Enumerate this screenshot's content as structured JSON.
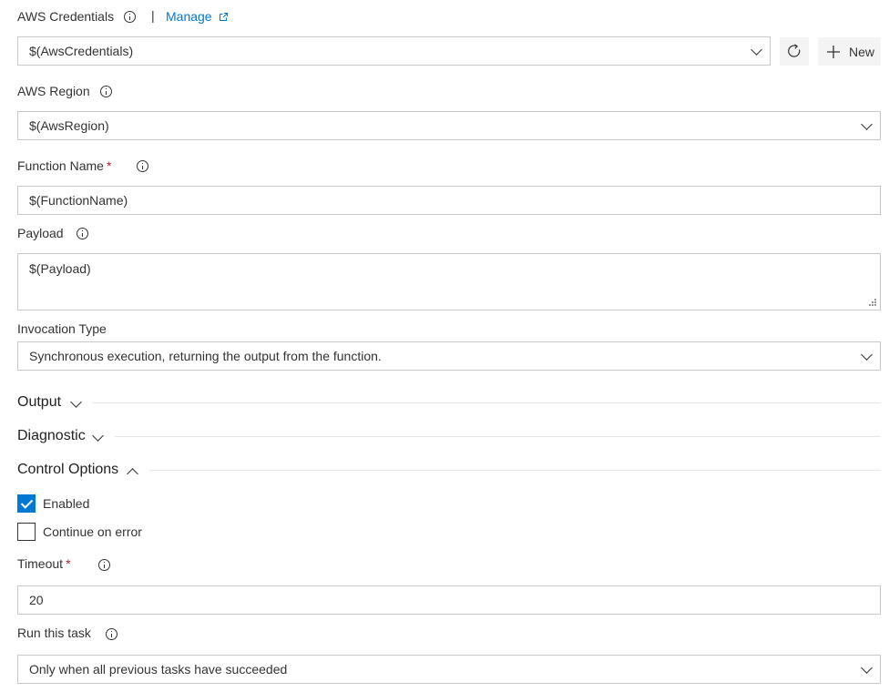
{
  "credentials": {
    "label": "AWS Credentials",
    "separator": "|",
    "manage_label": "Manage",
    "value": "$(AwsCredentials)",
    "new_label": "New"
  },
  "region": {
    "label": "AWS Region",
    "value": "$(AwsRegion)"
  },
  "function_name": {
    "label": "Function Name",
    "required": "*",
    "value": "$(FunctionName)"
  },
  "payload": {
    "label": "Payload",
    "value": "$(Payload)"
  },
  "invocation_type": {
    "label": "Invocation Type",
    "value": "Synchronous execution, returning the output from the function."
  },
  "sections": {
    "output": "Output",
    "diagnostic": "Diagnostic",
    "control_options": "Control Options"
  },
  "control": {
    "enabled_label": "Enabled",
    "enabled_checked": true,
    "continue_label": "Continue on error",
    "continue_checked": false,
    "timeout_label": "Timeout",
    "timeout_required": "*",
    "timeout_value": "20",
    "run_label": "Run this task",
    "run_value": "Only when all previous tasks have succeeded"
  },
  "colors": {
    "accent": "#0078d4",
    "required": "#a4262c",
    "border": "#c8c8c8"
  }
}
